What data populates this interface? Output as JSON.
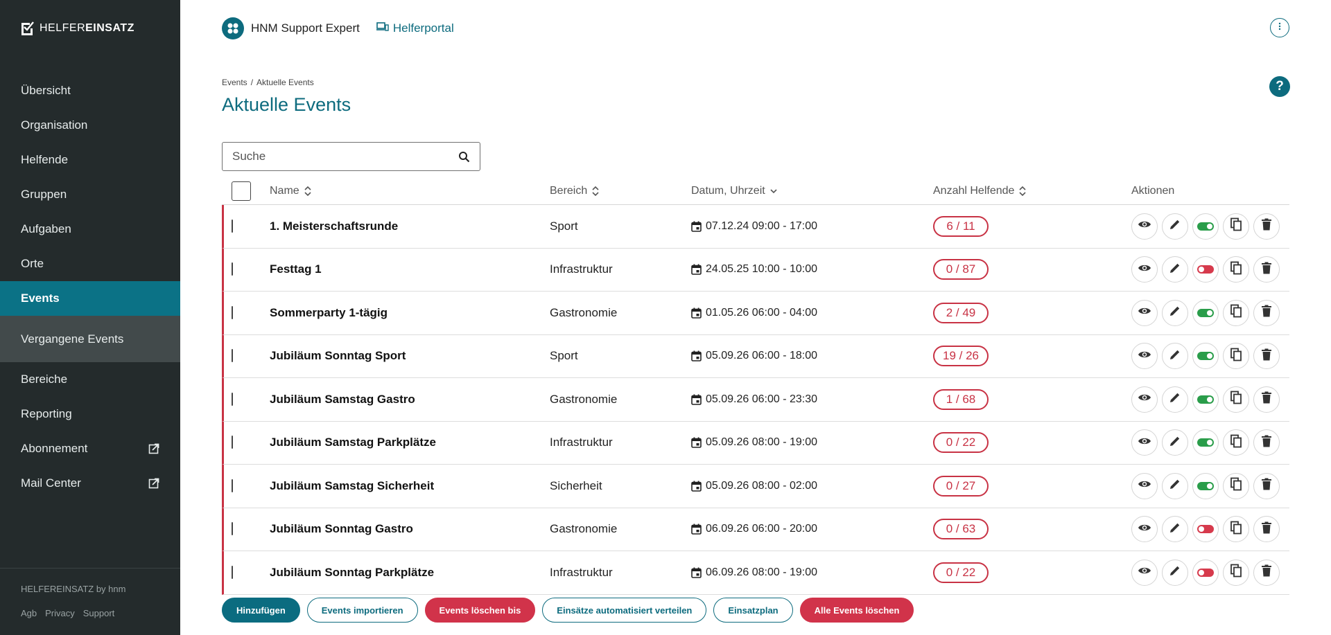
{
  "brand": {
    "part1": "HELFER",
    "part2": "EINSATZ"
  },
  "sidebar": {
    "items": [
      {
        "label": "Übersicht",
        "id": "uebersicht"
      },
      {
        "label": "Organisation",
        "id": "organisation"
      },
      {
        "label": "Helfende",
        "id": "helfende"
      },
      {
        "label": "Gruppen",
        "id": "gruppen"
      },
      {
        "label": "Aufgaben",
        "id": "aufgaben"
      },
      {
        "label": "Orte",
        "id": "orte"
      },
      {
        "label": "Events",
        "id": "events"
      },
      {
        "label": "Vergangene Events",
        "id": "vergangene-events"
      },
      {
        "label": "Bereiche",
        "id": "bereiche"
      },
      {
        "label": "Reporting",
        "id": "reporting"
      },
      {
        "label": "Abonnement",
        "id": "abonnement"
      },
      {
        "label": "Mail Center",
        "id": "mail-center"
      }
    ],
    "footer": {
      "credit": "HELFEREINSATZ by hnm",
      "links": [
        "Agb",
        "Privacy",
        "Support"
      ]
    }
  },
  "topbar": {
    "org_name": "HNM Support Expert",
    "portal_label": "Helferportal"
  },
  "breadcrumb": [
    "Events",
    "Aktuelle Events"
  ],
  "page_title": "Aktuelle Events",
  "search": {
    "placeholder": "Suche",
    "value": ""
  },
  "table": {
    "headers": {
      "name": "Name",
      "bereich": "Bereich",
      "datum": "Datum, Uhrzeit",
      "anzahl": "Anzahl Helfende",
      "aktionen": "Aktionen"
    },
    "rows": [
      {
        "name": "1. Meisterschaftsrunde",
        "bereich": "Sport",
        "datum": "07.12.24 09:00 - 17:00",
        "anzahl": "6 / 11",
        "active": true
      },
      {
        "name": "Festtag 1",
        "bereich": "Infrastruktur",
        "datum": "24.05.25 10:00 - 10:00",
        "anzahl": "0 / 87",
        "active": false
      },
      {
        "name": "Sommerparty 1-tägig",
        "bereich": "Gastronomie",
        "datum": "01.05.26 06:00 - 04:00",
        "anzahl": "2 / 49",
        "active": true
      },
      {
        "name": "Jubiläum Sonntag Sport",
        "bereich": "Sport",
        "datum": "05.09.26 06:00 - 18:00",
        "anzahl": "19 / 26",
        "active": true
      },
      {
        "name": "Jubiläum Samstag Gastro",
        "bereich": "Gastronomie",
        "datum": "05.09.26 06:00 - 23:30",
        "anzahl": "1 / 68",
        "active": true
      },
      {
        "name": "Jubiläum Samstag Parkplätze",
        "bereich": "Infrastruktur",
        "datum": "05.09.26 08:00 - 19:00",
        "anzahl": "0 / 22",
        "active": true
      },
      {
        "name": "Jubiläum Samstag Sicherheit",
        "bereich": "Sicherheit",
        "datum": "05.09.26 08:00 - 02:00",
        "anzahl": "0 / 27",
        "active": true
      },
      {
        "name": "Jubiläum Sonntag Gastro",
        "bereich": "Gastronomie",
        "datum": "06.09.26 06:00 - 20:00",
        "anzahl": "0 / 63",
        "active": false
      },
      {
        "name": "Jubiläum Sonntag Parkplätze",
        "bereich": "Infrastruktur",
        "datum": "06.09.26 08:00 - 19:00",
        "anzahl": "0 / 22",
        "active": false
      }
    ]
  },
  "buttons": {
    "add": "Hinzufügen",
    "import": "Events importieren",
    "delete_until": "Events löschen bis",
    "auto_assign": "Einsätze automatisiert verteilen",
    "schedule": "Einsatzplan",
    "delete_all": "Alle Events löschen"
  },
  "colors": {
    "sidebar_bg": "#242b2c",
    "accent": "#0b7286",
    "danger": "#c83244",
    "toggle_on": "#2a9d4a",
    "toggle_off": "#d63a4c"
  }
}
